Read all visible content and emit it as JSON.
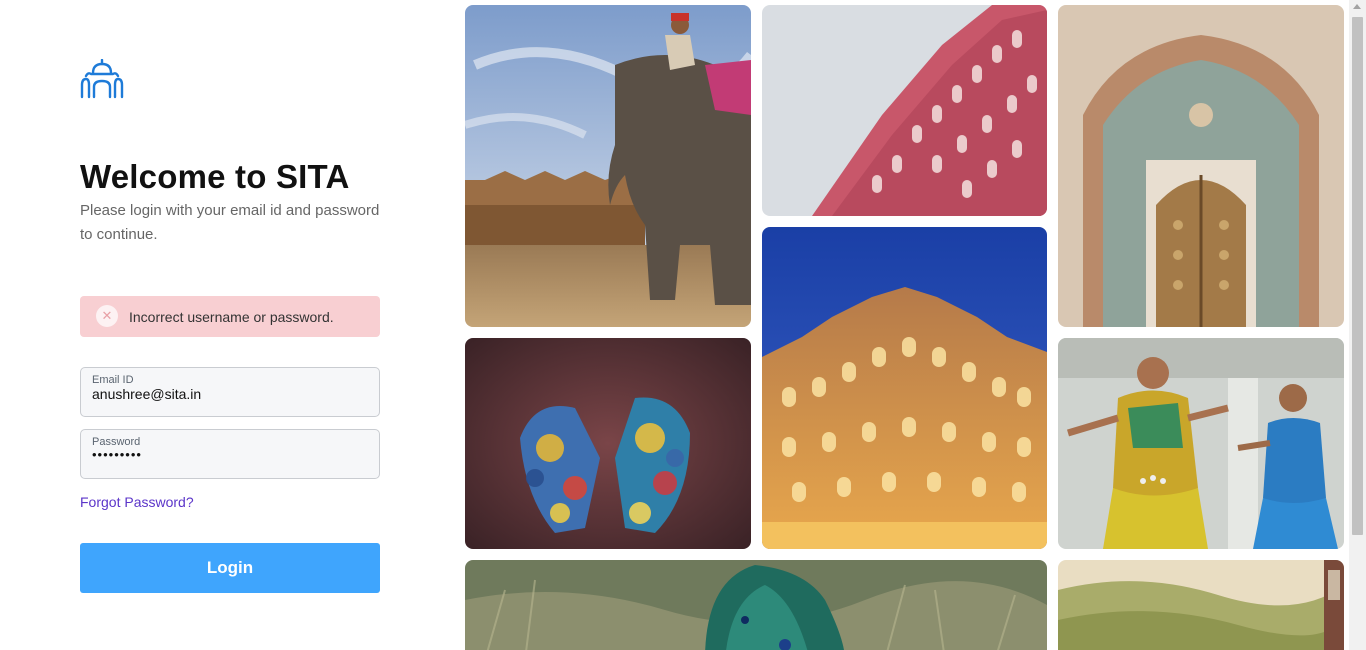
{
  "brand": {
    "logo_icon": "palace-dome-icon",
    "accent_color": "#1e7bd8"
  },
  "login": {
    "title": "Welcome to SITA",
    "subtitle": "Please login with your email id and password to continue.",
    "error": {
      "icon": "close-icon",
      "message": "Incorrect username or password.",
      "background": "#f8cfd2"
    },
    "email": {
      "label": "Email ID",
      "value": "anushree@sita.in"
    },
    "password": {
      "label": "Password",
      "value": "•••••••••"
    },
    "forgot_password": "Forgot Password?",
    "submit_label": "Login",
    "button_color": "#3fa5fd"
  },
  "gallery": {
    "images": [
      "elephant-at-fort-photo",
      "hawa-mahal-facade-photo",
      "ornate-palace-door-photo",
      "holi-colored-hands-photo",
      "hawa-mahal-night-photo",
      "classical-dancers-photo",
      "peacock-photo",
      "green-hills-photo"
    ]
  }
}
